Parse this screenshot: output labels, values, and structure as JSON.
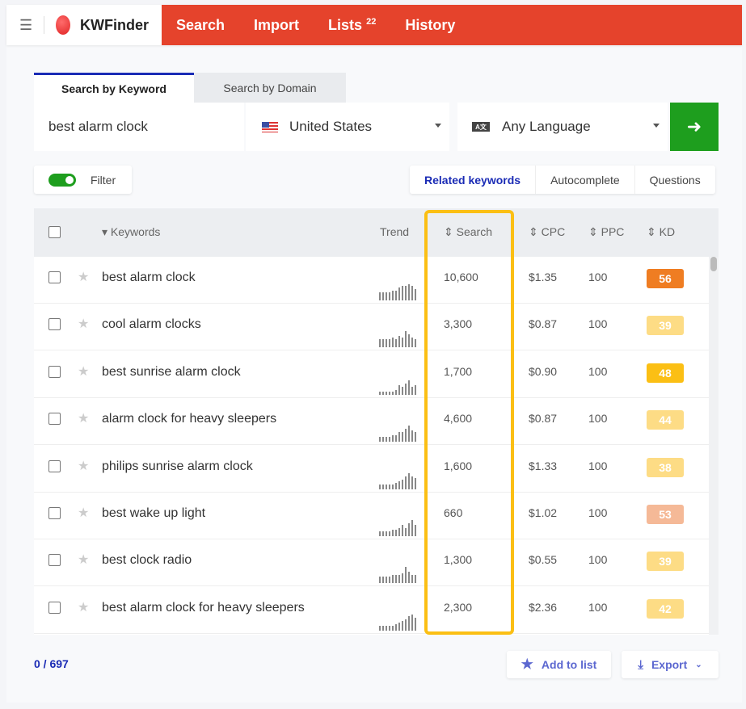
{
  "header": {
    "brand": "KWFinder",
    "nav": [
      {
        "label": "Search"
      },
      {
        "label": "Import"
      },
      {
        "label": "Lists",
        "badge": "22"
      },
      {
        "label": "History"
      }
    ]
  },
  "search": {
    "tabs": [
      {
        "label": "Search by Keyword",
        "active": true
      },
      {
        "label": "Search by Domain"
      }
    ],
    "keyword": "best alarm clock",
    "country": "United States",
    "language": "Any Language",
    "language_icon": "translate-icon"
  },
  "filter": {
    "label": "Filter",
    "on": true
  },
  "result_tabs": [
    {
      "label": "Related keywords",
      "active": true
    },
    {
      "label": "Autocomplete"
    },
    {
      "label": "Questions"
    }
  ],
  "table": {
    "columns": {
      "keywords": "Keywords",
      "trend": "Trend",
      "search": "Search",
      "cpc": "CPC",
      "ppc": "PPC",
      "kd": "KD"
    },
    "rows": [
      {
        "keyword": "best alarm clock",
        "search": "10,600",
        "cpc": "$1.35",
        "ppc": "100",
        "kd": "56",
        "kd_color": "#ef7d22",
        "trend": [
          5,
          5,
          5,
          5,
          6,
          6,
          8,
          9,
          9,
          10,
          9,
          7
        ]
      },
      {
        "keyword": "cool alarm clocks",
        "search": "3,300",
        "cpc": "$0.87",
        "ppc": "100",
        "kd": "39",
        "kd_color": "#fddc85",
        "trend": [
          5,
          5,
          5,
          5,
          6,
          5,
          7,
          6,
          10,
          8,
          6,
          5
        ]
      },
      {
        "keyword": "best sunrise alarm clock",
        "search": "1,700",
        "cpc": "$0.90",
        "ppc": "100",
        "kd": "48",
        "kd_color": "#fbbf14",
        "trend": [
          2,
          2,
          2,
          2,
          2,
          3,
          6,
          5,
          7,
          9,
          5,
          6
        ]
      },
      {
        "keyword": "alarm clock for heavy sleepers",
        "search": "4,600",
        "cpc": "$0.87",
        "ppc": "100",
        "kd": "44",
        "kd_color": "#fddc85",
        "trend": [
          3,
          3,
          3,
          3,
          4,
          4,
          6,
          6,
          8,
          10,
          7,
          6
        ]
      },
      {
        "keyword": "philips sunrise alarm clock",
        "search": "1,600",
        "cpc": "$1.33",
        "ppc": "100",
        "kd": "38",
        "kd_color": "#fddc85",
        "trend": [
          3,
          3,
          3,
          3,
          3,
          4,
          5,
          6,
          8,
          10,
          8,
          7
        ]
      },
      {
        "keyword": "best wake up light",
        "search": "660",
        "cpc": "$1.02",
        "ppc": "100",
        "kd": "53",
        "kd_color": "#f5b997",
        "trend": [
          3,
          3,
          3,
          3,
          4,
          4,
          5,
          7,
          5,
          8,
          10,
          7
        ]
      },
      {
        "keyword": "best clock radio",
        "search": "1,300",
        "cpc": "$0.55",
        "ppc": "100",
        "kd": "39",
        "kd_color": "#fddc85",
        "trend": [
          4,
          4,
          4,
          4,
          5,
          5,
          5,
          6,
          10,
          7,
          5,
          5
        ]
      },
      {
        "keyword": "best alarm clock for heavy sleepers",
        "search": "2,300",
        "cpc": "$2.36",
        "ppc": "100",
        "kd": "42",
        "kd_color": "#fddc85",
        "trend": [
          3,
          3,
          3,
          3,
          3,
          4,
          5,
          6,
          7,
          9,
          10,
          8
        ]
      }
    ]
  },
  "footer": {
    "count": "0 / 697",
    "add_to_list": "Add to list",
    "export": "Export"
  },
  "colors": {
    "brand_red": "#e5432c",
    "accent_blue": "#1a2bb5",
    "go_green": "#1e9e1e",
    "highlight": "#fbbf14"
  }
}
